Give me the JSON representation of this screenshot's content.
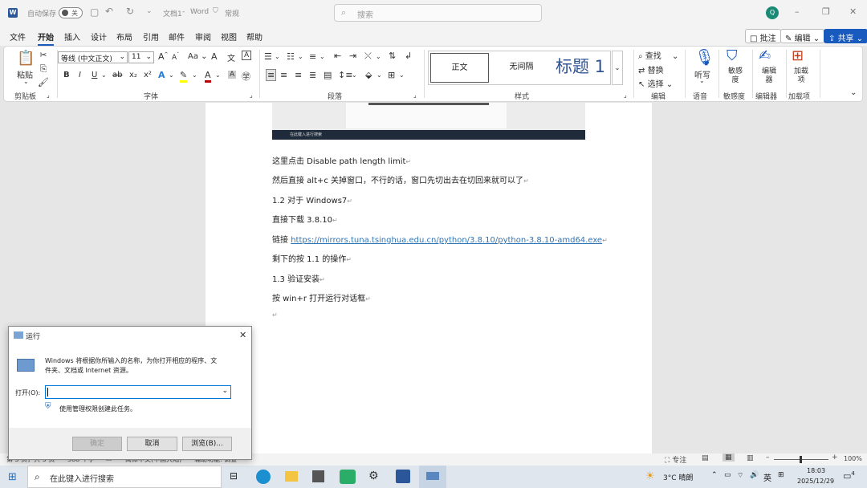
{
  "app": {
    "autosave_label": "自动保存",
    "autosave_state": "关",
    "doc_title": "文档1",
    "app_name": "Word",
    "status": "常规",
    "search_placeholder": "搜索",
    "user_initial": "Q"
  },
  "tabs": [
    "文件",
    "开始",
    "插入",
    "设计",
    "布局",
    "引用",
    "邮件",
    "审阅",
    "视图",
    "帮助"
  ],
  "header_buttons": {
    "comment": "批注",
    "edit": "编辑",
    "share": "共享"
  },
  "ribbon": {
    "clipboard": {
      "paste": "粘贴",
      "label": "剪贴板"
    },
    "font": {
      "name": "等线 (中文正文)",
      "size": "11",
      "label": "字体",
      "bold": "B",
      "italic": "I",
      "underline": "U",
      "strike": "ab",
      "sub": "x₂",
      "sup": "x²",
      "grow": "A",
      "shrink": "A",
      "case": "Aa",
      "clear": "A",
      "wen": "文",
      "charbox": "A"
    },
    "paragraph": {
      "label": "段落"
    },
    "styles": {
      "items": [
        "正文",
        "无间隔",
        "标题 1"
      ],
      "label": "样式"
    },
    "editing": {
      "find": "查找",
      "replace": "替换",
      "select": "选择",
      "label": "编辑"
    },
    "voice": {
      "dictate": "听写",
      "label": "语音"
    },
    "sensitivity": {
      "name": "敏感度",
      "label": "敏感度"
    },
    "editor": {
      "name": "编辑器",
      "label": "编辑器"
    },
    "addins": {
      "name": "加载项",
      "label": "加载项"
    }
  },
  "document": {
    "lines": [
      "这里点击 Disable path length limit",
      "然后直接 alt+c 关掉窗口，不行的话，窗口先切出去在切回来就可以了",
      "1.2 对于 Windows7",
      "直接下载 3.8.10",
      "链接",
      "https://mirrors.tuna.tsinghua.edu.cn/python/3.8.10/python-3.8.10-amd64.exe",
      "剩下的按 1.1 的操作",
      "1.3 验证安装",
      "按 win+r 打开运行对话框"
    ],
    "image_text": "在此键入进行搜索"
  },
  "run_dialog": {
    "title": "运行",
    "description_line1": "Windows 将根据你所输入的名称，为你打开相应的程序、文",
    "description_line2": "件夹、文档或 Internet 资源。",
    "open_label": "打开(O):",
    "input_value": "",
    "admin_text": "使用管理权限创建此任务。",
    "ok": "确定",
    "cancel": "取消",
    "browse": "浏览(B)..."
  },
  "statusbar": {
    "page": "第 5 页，共 5 页",
    "words": "388 个字",
    "lang": "简体中文(中国大陆)",
    "accessibility": "辅助功能: 调查",
    "focus": "专注",
    "zoom": "100%"
  },
  "taskbar": {
    "search_placeholder": "在此键入进行搜索",
    "weather": "3°C 晴朗",
    "ime": "英",
    "time": "18:03",
    "date": "2025/12/29",
    "notifications": "4"
  },
  "colors": {
    "accent": "#185abd",
    "word_blue": "#2b579a",
    "highlight": "#ffff00",
    "font_red": "#c00000"
  }
}
